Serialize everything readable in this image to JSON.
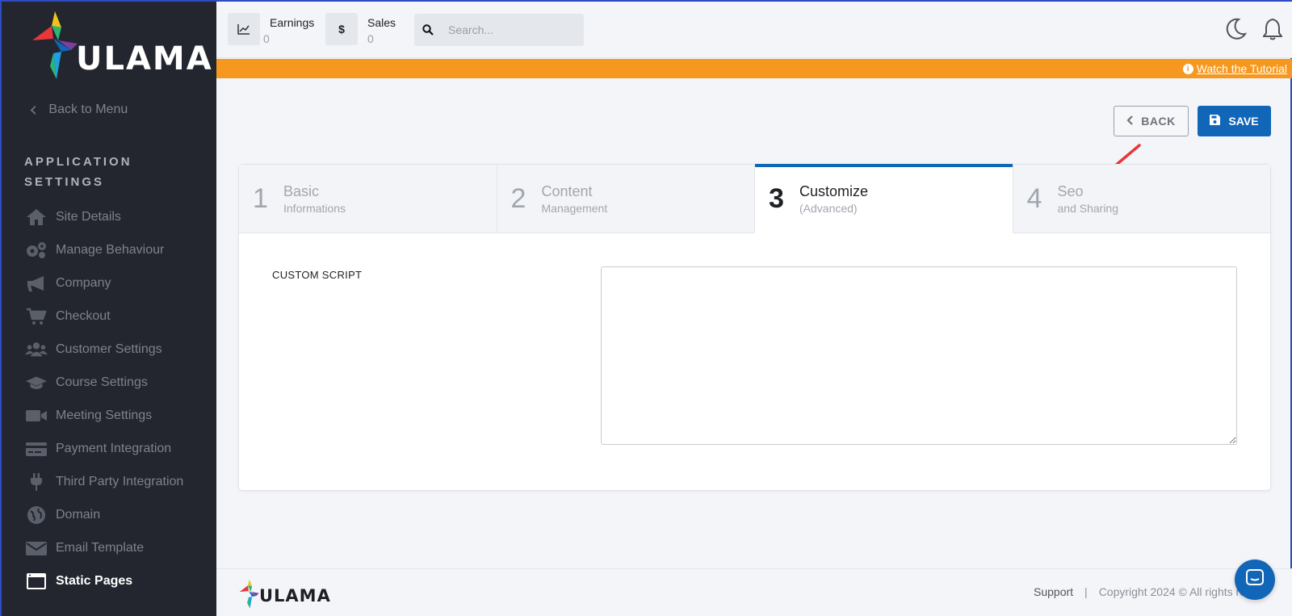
{
  "brand": {
    "name": "ULAMA"
  },
  "sidebar": {
    "back_label": "Back to Menu",
    "section_title": "APPLICATION SETTINGS",
    "items": [
      {
        "label": "Site Details",
        "icon": "home-icon"
      },
      {
        "label": "Manage Behaviour",
        "icon": "gears-icon"
      },
      {
        "label": "Company",
        "icon": "megaphone-icon"
      },
      {
        "label": "Checkout",
        "icon": "cart-icon"
      },
      {
        "label": "Customer Settings",
        "icon": "users-icon"
      },
      {
        "label": "Course Settings",
        "icon": "graduation-cap-icon"
      },
      {
        "label": "Meeting Settings",
        "icon": "video-icon"
      },
      {
        "label": "Payment Integration",
        "icon": "credit-card-icon"
      },
      {
        "label": "Third Party Integration",
        "icon": "plug-icon"
      },
      {
        "label": "Domain",
        "icon": "globe-icon"
      },
      {
        "label": "Email Template",
        "icon": "envelope-icon"
      },
      {
        "label": "Static Pages",
        "icon": "window-icon",
        "active": true
      }
    ]
  },
  "topbar": {
    "earnings": {
      "label": "Earnings",
      "value": "0"
    },
    "sales": {
      "label": "Sales",
      "value": "0",
      "symbol": "$"
    },
    "search_placeholder": "Search..."
  },
  "banner": {
    "link_label": "Watch the Tutorial",
    "color": "#f6981f"
  },
  "actions": {
    "back_label": "BACK",
    "save_label": "SAVE"
  },
  "steps": [
    {
      "num": "1",
      "title": "Basic",
      "subtitle": "Informations",
      "active": false
    },
    {
      "num": "2",
      "title": "Content",
      "subtitle": "Management",
      "active": false
    },
    {
      "num": "3",
      "title": "Customize",
      "subtitle": "(Advanced)",
      "active": true
    },
    {
      "num": "4",
      "title": "Seo",
      "subtitle": "and Sharing",
      "active": false
    }
  ],
  "form": {
    "custom_script_label": "CUSTOM SCRIPT",
    "custom_script_value": ""
  },
  "footer": {
    "support_label": "Support",
    "separator": "|",
    "copyright": "Copyright 2024 © All rights res"
  },
  "colors": {
    "accent": "#1266b8",
    "sidebar_bg": "#23262f",
    "annotation": "#e8363a"
  }
}
